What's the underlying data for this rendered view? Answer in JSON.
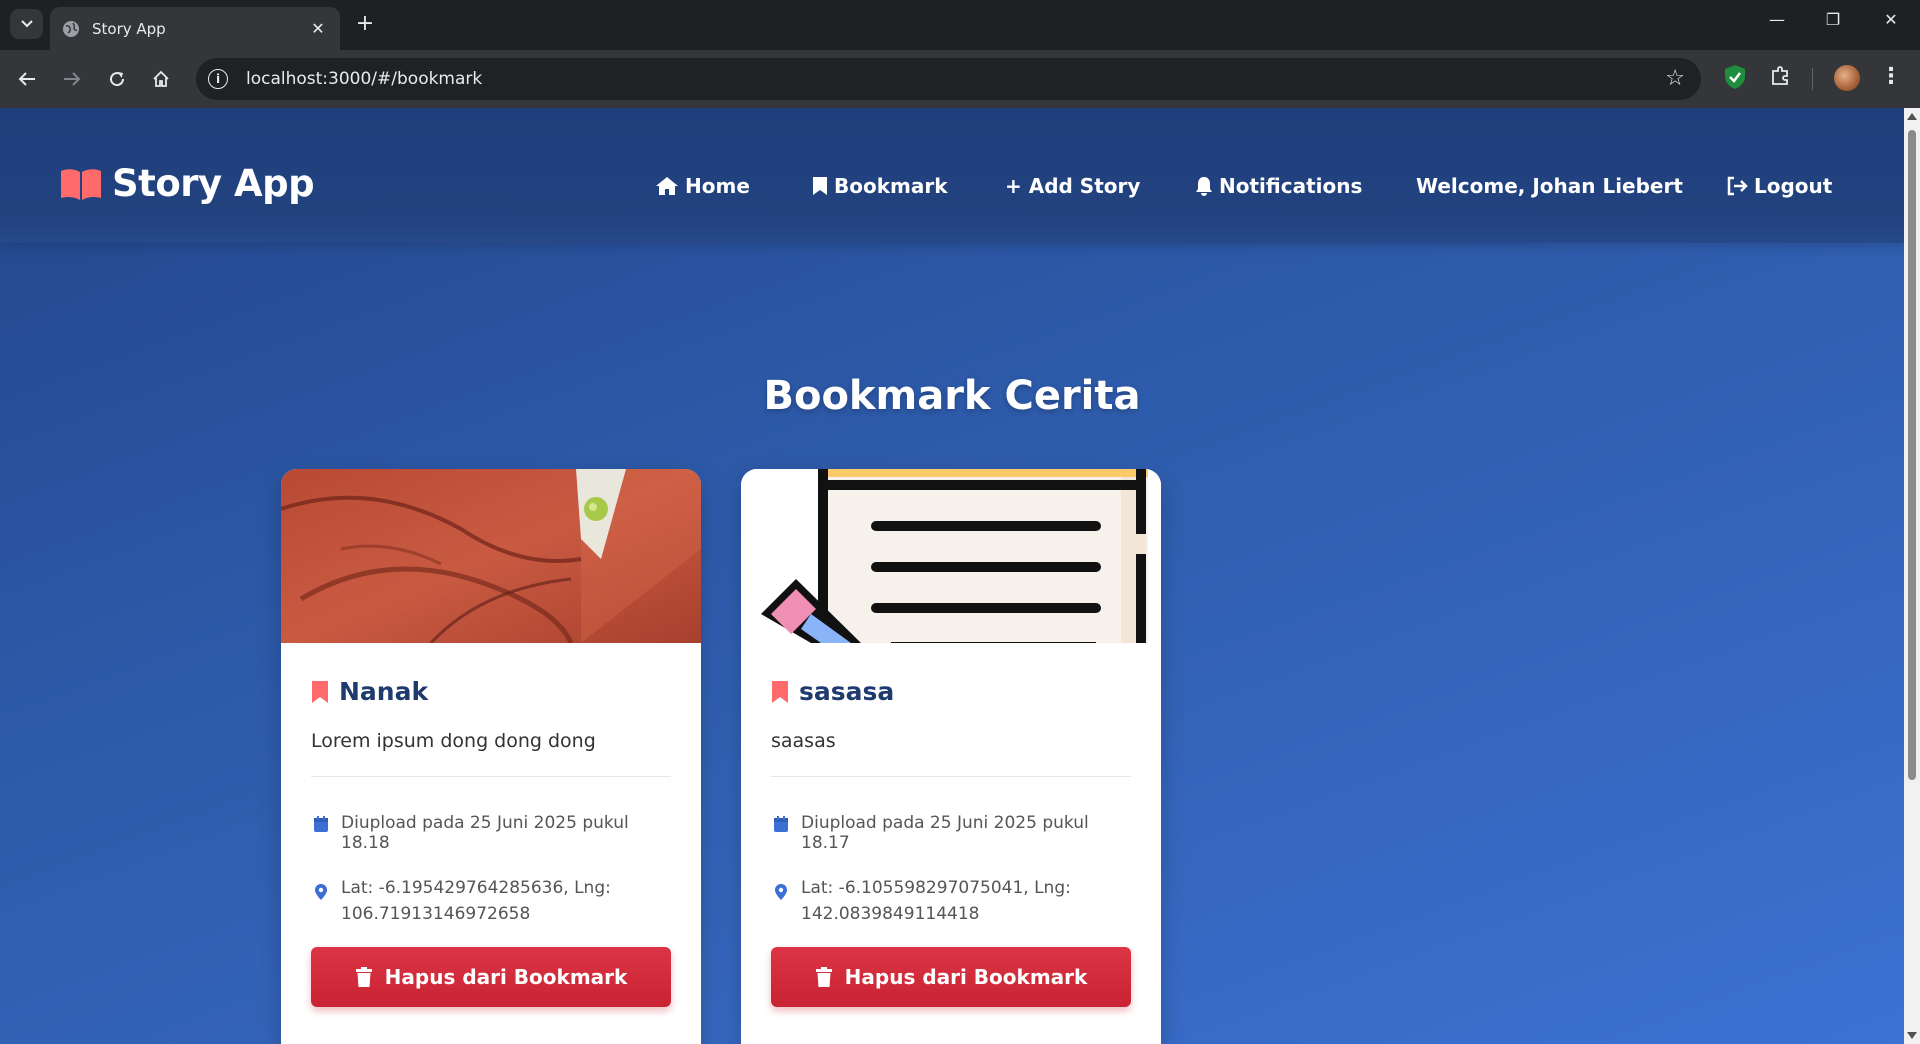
{
  "browser": {
    "tab_title": "Story App",
    "url": "localhost:3000/#/bookmark"
  },
  "app": {
    "brand": "Story App",
    "nav": {
      "home": "Home",
      "bookmark": "Bookmark",
      "add_story": "+ Add Story",
      "notifications": "Notifications",
      "welcome": "Welcome, Johan Liebert",
      "logout": "Logout"
    },
    "page_title": "Bookmark Cerita",
    "stories": [
      {
        "name": "Nanak",
        "description": "Lorem ipsum dong dong dong",
        "uploaded": "Diupload pada 25 Juni 2025 pukul 18.18",
        "location": "Lat: -6.195429764285636, Lng: 106.71913146972658",
        "delete_label": "Hapus dari Bookmark"
      },
      {
        "name": "sasasa",
        "description": "saasas",
        "uploaded": "Diupload pada 25 Juni 2025 pukul 18.17",
        "location": "Lat: -6.105598297075041, Lng: 142.0839849114418",
        "delete_label": "Hapus dari Bookmark"
      }
    ]
  },
  "colors": {
    "brand_accent": "#ff6b6b",
    "header_bg": "#1f3f7c",
    "danger": "#dc3545",
    "meta_icon": "#3b6fd4"
  }
}
